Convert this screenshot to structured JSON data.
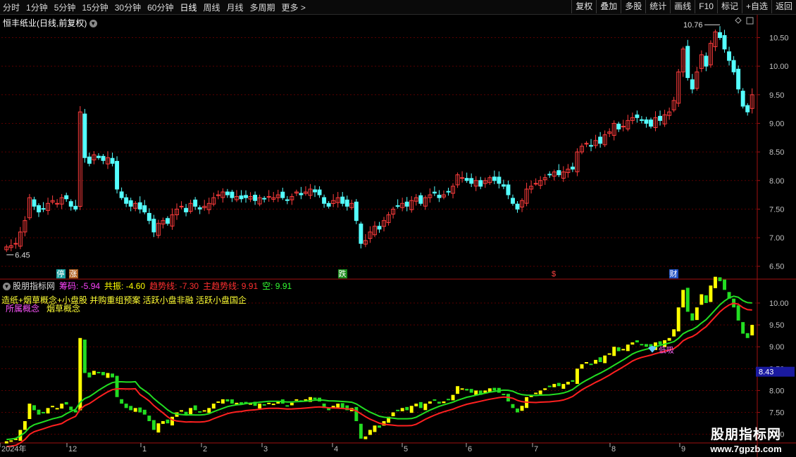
{
  "toolbar": {
    "periods": [
      "分时",
      "1分钟",
      "5分钟",
      "15分钟",
      "30分钟",
      "60分钟",
      "日线",
      "周线",
      "月线",
      "多周期",
      "更多"
    ],
    "active_period": "日线",
    "more_arrow": ">",
    "actions": [
      "复权",
      "叠加",
      "多股",
      "统计",
      "画线",
      "F10",
      "标记",
      "+自选",
      "返回"
    ]
  },
  "main_panel": {
    "stock_title": "恒丰纸业(日线,前复权)",
    "y_ticks": [
      "10.50",
      "10.00",
      "9.50",
      "9.00",
      "8.50",
      "8.00",
      "7.50",
      "7.00",
      "6.50"
    ],
    "high_label": "10.76",
    "low_label": "6.45",
    "event_tags": [
      "停",
      "涨",
      "跌",
      "$",
      "财"
    ],
    "corner_icons": [
      "diamond-icon",
      "square-icon"
    ]
  },
  "indicator_panel": {
    "name": "股朋指标网",
    "params": [
      {
        "label": "筹码",
        "value": "-5.94",
        "color": "#ff44ff"
      },
      {
        "label": "共振",
        "value": "-4.60",
        "color": "#ffff00"
      },
      {
        "label": "趋势线",
        "value": "-7.30",
        "color": "#ff3030"
      },
      {
        "label": "主趋势线",
        "value": "9.91",
        "color": "#ff3030"
      },
      {
        "label": "空",
        "value": "9.91",
        "color": "#33ff33"
      }
    ],
    "concepts_line1": "造纸+烟草概念+小盘股 并购重组预案 活跃小盘非融 活跃小盘国企",
    "concepts_line2a": "所属概念",
    "concepts_line2b": "烟草概念",
    "signal_label": "低吸",
    "y_ticks": [
      "10.00",
      "9.50",
      "9.00",
      "8.50",
      "8.00",
      "7.50",
      "7.00"
    ],
    "price_box": "8.43"
  },
  "x_axis": {
    "labels": [
      "2024年",
      "12",
      "1",
      "2",
      "3",
      "4",
      "5",
      "6",
      "7",
      "8",
      "9"
    ]
  },
  "watermark": {
    "title": "股朋指标网",
    "url": "www.7gpzb.com"
  },
  "colors": {
    "up": "#ff3c3c",
    "down": "#54ffff",
    "grid": "#5a0000",
    "axis": "#a01010",
    "trend": "#ff2020",
    "green": "#22dd22",
    "yellow": "#ffff00"
  },
  "chart_data": {
    "type": "candlestick",
    "period": "daily",
    "ylim": [
      6.3,
      10.85
    ],
    "x_ticks": [
      "2024年",
      "12",
      "1",
      "2",
      "3",
      "4",
      "5",
      "6",
      "7",
      "8",
      "9"
    ],
    "close": [
      6.84,
      6.86,
      6.9,
      7.1,
      7.3,
      7.7,
      7.55,
      7.45,
      7.5,
      7.6,
      7.65,
      7.6,
      7.7,
      7.68,
      7.55,
      7.5,
      9.2,
      8.4,
      8.3,
      8.45,
      8.4,
      8.35,
      8.4,
      8.3,
      7.85,
      7.7,
      7.6,
      7.55,
      7.6,
      7.5,
      7.45,
      7.3,
      7.1,
      7.25,
      7.3,
      7.25,
      7.4,
      7.5,
      7.55,
      7.45,
      7.6,
      7.55,
      7.5,
      7.55,
      7.6,
      7.7,
      7.75,
      7.8,
      7.75,
      7.7,
      7.72,
      7.68,
      7.7,
      7.72,
      7.65,
      7.7,
      7.68,
      7.72,
      7.7,
      7.75,
      7.7,
      7.65,
      7.72,
      7.8,
      7.75,
      7.8,
      7.85,
      7.8,
      7.75,
      7.6,
      7.55,
      7.65,
      7.7,
      7.6,
      7.55,
      7.6,
      7.3,
      6.9,
      6.95,
      7.1,
      7.2,
      7.15,
      7.3,
      7.4,
      7.5,
      7.55,
      7.6,
      7.55,
      7.65,
      7.7,
      7.6,
      7.7,
      7.75,
      7.78,
      7.7,
      7.75,
      7.8,
      7.9,
      8.1,
      8.05,
      8.0,
      7.95,
      8.0,
      7.9,
      8.0,
      8.05,
      8.0,
      7.95,
      7.9,
      7.75,
      7.6,
      7.5,
      7.65,
      7.85,
      7.9,
      7.95,
      8.0,
      8.05,
      8.1,
      8.15,
      8.1,
      8.15,
      8.2,
      8.2,
      8.5,
      8.6,
      8.65,
      8.6,
      8.7,
      8.65,
      8.8,
      8.85,
      9.0,
      8.9,
      8.95,
      9.05,
      9.1,
      9.1,
      9.05,
      9.0,
      8.95,
      9.1,
      9.05,
      9.15,
      9.2,
      9.4,
      9.9,
      10.3,
      9.8,
      9.6,
      9.9,
      10.2,
      10.0,
      10.4,
      10.6,
      10.5,
      10.3,
      10.1,
      9.9,
      9.6,
      9.3,
      9.2,
      9.5
    ],
    "indicator_series": [
      {
        "name": "主趋势线",
        "color": "#ff3030",
        "value": 9.91
      },
      {
        "name": "空",
        "color": "#33ff33",
        "value": 9.91
      }
    ],
    "annotations": [
      {
        "text": "10.76",
        "type": "high"
      },
      {
        "text": "6.45",
        "type": "low"
      }
    ]
  }
}
